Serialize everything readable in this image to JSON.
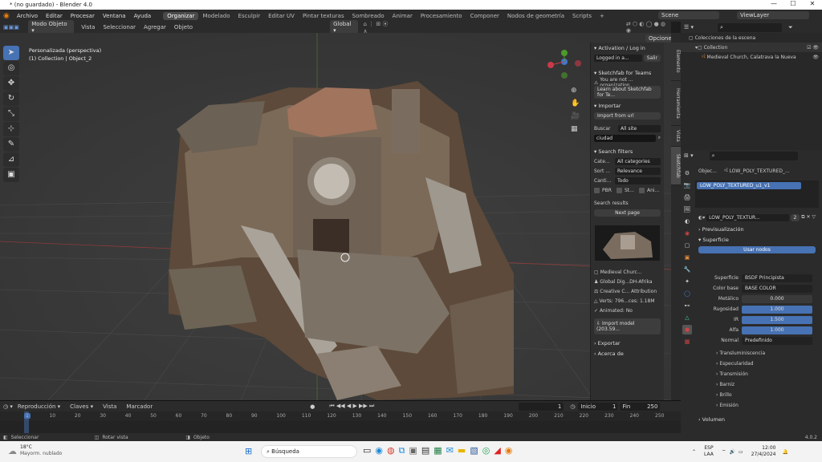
{
  "window": {
    "title": "* (no guardado) - Blender 4.0",
    "min": "—",
    "max": "☐",
    "close": "✕"
  },
  "menu": {
    "items": [
      "Archivo",
      "Editar",
      "Procesar",
      "Ventana",
      "Ayuda"
    ],
    "workspaces": [
      "Organizar",
      "Modelado",
      "Esculpir",
      "Editar UV",
      "Pintar texturas",
      "Sombreado",
      "Animar",
      "Procesamiento",
      "Componer",
      "Nodos de geometría",
      "Scripts"
    ],
    "add_ws": "+",
    "scene": "Scene",
    "view_layer": "ViewLayer"
  },
  "viewport_header": {
    "mode": "Modo Objeto",
    "items": [
      "Vista",
      "Seleccionar",
      "Agregar",
      "Objeto"
    ],
    "orientation": "Global",
    "options": "Opciones"
  },
  "viewport": {
    "line1": "Personalizada (perspectiva)",
    "line2": "(1) Collection | Object_2"
  },
  "npanel": {
    "activation": "Activation / Log in",
    "logged": "Logged in a...",
    "salir": "Salir",
    "teams": "Sketchfab for Teams",
    "not_org": "You are not ... organization",
    "learn": "Learn about Sketchfab for Te...",
    "importar": "Importar",
    "import_url": "Import from url",
    "buscar": "Buscar",
    "all_site": "All site",
    "query": "ciudad",
    "filters": "Search filters",
    "f_rows": [
      {
        "k": "Cate...",
        "v": "All categories"
      },
      {
        "k": "Sort ...",
        "v": "Relevance"
      },
      {
        "k": "Canti...",
        "v": "Todo"
      }
    ],
    "chk": [
      "PBR",
      "St...",
      "Ani..."
    ],
    "results": "Search results",
    "next": "Next page",
    "info": [
      "Medieval Churc...",
      "Global Dig...DH-Afrika",
      "Creative C... Attribution",
      "Verts: 796...ces: 1.18M",
      "Animated: No"
    ],
    "import_model": "Import model (203.59...",
    "exportar": "Exportar",
    "acerca": "Acerca de"
  },
  "side_tabs": [
    "Elemento",
    "Herramienta",
    "Vista",
    "Sketchfab"
  ],
  "outliner": {
    "title": "Colecciones de la escena",
    "items": [
      "Collection",
      "Medieval Church, Calatrava la Nueva"
    ]
  },
  "props": {
    "obj": "Objec...",
    "mesh": "LOW_POLY_TEXTURED_...",
    "slot": "LOW_POLY_TEXTURED_u1_v1",
    "mat": "LOW_POLY_TEXTUR...",
    "users": "2",
    "preview": "Previsualización",
    "surface": "Superficie",
    "use_nodes": "Usar nodos",
    "rows": [
      {
        "l": "Superficie",
        "v": "BSDF Principista",
        "type": "dark"
      },
      {
        "l": "Color base",
        "v": "BASE COLOR",
        "type": "dark"
      },
      {
        "l": "Metálico",
        "v": "0.000",
        "type": "grey"
      },
      {
        "l": "Rugosidad",
        "v": "1.000",
        "type": "blue"
      },
      {
        "l": "IR",
        "v": "1.500",
        "type": "blue"
      },
      {
        "l": "Alfa",
        "v": "1.000",
        "type": "blue"
      },
      {
        "l": "Normal",
        "v": "Predefinido",
        "type": "dark"
      }
    ],
    "subs": [
      "Transluminiscencia",
      "Especularidad",
      "Transmisión",
      "Barniz",
      "Brillo",
      "Emisión"
    ],
    "volumen": "Volumen"
  },
  "timeline": {
    "menu": [
      "Reproducción",
      "Claves",
      "Vista",
      "Marcador"
    ],
    "frame": "1",
    "inicio": "Inicio",
    "start": "1",
    "fin": "Fin",
    "end": "250",
    "ticks": [
      "1",
      "10",
      "20",
      "30",
      "40",
      "50",
      "60",
      "70",
      "80",
      "90",
      "100",
      "110",
      "120",
      "130",
      "140",
      "150",
      "160",
      "170",
      "180",
      "190",
      "200",
      "210",
      "220",
      "230",
      "240",
      "250"
    ]
  },
  "status": {
    "a": "Seleccionar",
    "b": "Rotar vista",
    "c": "Objeto",
    "ver": "4.0.2"
  },
  "taskbar": {
    "temp": "18°C",
    "weather": "Mayorm. nublado",
    "search": "Búsqueda",
    "lang": "ESP",
    "lang2": "LAA",
    "time": "12:00",
    "date": "27/4/2024"
  }
}
